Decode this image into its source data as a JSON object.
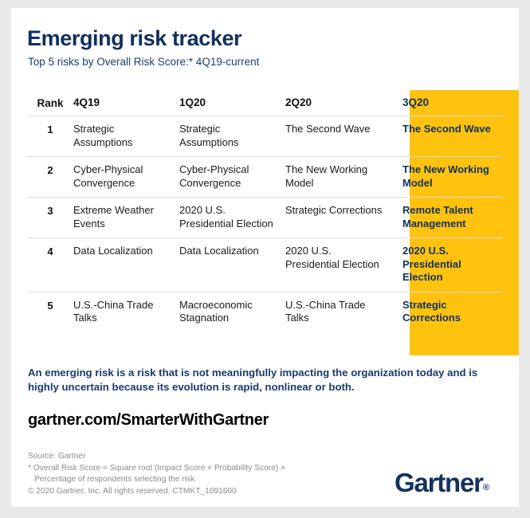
{
  "header": {
    "title": "Emerging risk tracker",
    "subtitle": "Top 5 risks by Overall Risk Score:* 4Q19-current"
  },
  "table": {
    "columns": [
      "Rank",
      "4Q19",
      "1Q20",
      "2Q20",
      "3Q20"
    ],
    "highlight_column": "3Q20",
    "highlight_color": "#ffc20e",
    "rows": [
      {
        "rank": "1",
        "q4_19": "Strategic Assumptions",
        "q1_20": "Strategic Assumptions",
        "q2_20": "The Second Wave",
        "q3_20": "The Second Wave"
      },
      {
        "rank": "2",
        "q4_19": "Cyber-Physical Convergence",
        "q1_20": "Cyber-Physical Convergence",
        "q2_20": "The New Working Model",
        "q3_20": "The New Working Model"
      },
      {
        "rank": "3",
        "q4_19": "Extreme Weather Events",
        "q1_20": "2020 U.S. Presidential Election",
        "q2_20": "Strategic Corrections",
        "q3_20": "Remote Talent Management"
      },
      {
        "rank": "4",
        "q4_19": "Data Localization",
        "q1_20": "Data Localization",
        "q2_20": "2020 U.S. Presidential Election",
        "q3_20": "2020 U.S. Presidential Election"
      },
      {
        "rank": "5",
        "q4_19": "U.S.-China Trade Talks",
        "q1_20": "Macroeconomic Stagnation",
        "q2_20": "U.S.-China Trade Talks",
        "q3_20": "Strategic Corrections"
      }
    ]
  },
  "callout": {
    "text": "An emerging risk is a risk that is not meaningfully impacting the organization today and is highly uncertain because its evolution is rapid, nonlinear or both."
  },
  "url": {
    "text": "gartner.com/SmarterWithGartner"
  },
  "footer": {
    "source": "Source: Gartner",
    "footnote_line1": "* Overall Risk Score = Square root (Impact Score × Probability Score) ×",
    "footnote_line2": "Percentage of respondents selecting the risk",
    "copyright": "© 2020 Gartner, Inc. All rights reserved. CTMKT_1091600",
    "logo_text": "Gartner",
    "logo_mark": "®"
  }
}
